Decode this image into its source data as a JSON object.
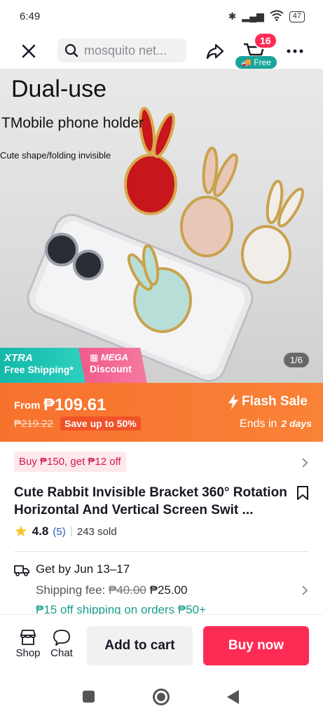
{
  "status_bar": {
    "time": "6:49",
    "battery": "47"
  },
  "topbar": {
    "search_text": "mosquito net...",
    "cart_count": "16",
    "free_chip": "Free"
  },
  "hero": {
    "headline": "Dual-use",
    "subline": "TMobile phone holder",
    "tagline": "Cute shape/folding invisible",
    "image_counter": "1/6",
    "xtra_title": "XTRA",
    "xtra_sub": "Free Shipping*",
    "mega_title": "MEGA",
    "mega_sub": "Discount"
  },
  "flash": {
    "from_label": "From",
    "price": "₱109.61",
    "original_price": "₱219.22",
    "save_text": "Save up to 50%",
    "title": "Flash Sale",
    "ends_label": "Ends in",
    "ends_value": "2 days"
  },
  "promo": {
    "text": "Buy ₱150, get ₱12 off"
  },
  "product": {
    "title": "Cute Rabbit Invisible Bracket 360° Rotation Horizontal And Vertical Screen Swit ...",
    "rating": "4.8",
    "review_count": "(5)",
    "sold": "243 sold"
  },
  "shipping": {
    "delivery": "Get by Jun 13–17",
    "fee_label": "Shipping fee:",
    "fee_old": "₱40.00",
    "fee_new": "₱25.00",
    "discount": "₱15 off shipping on orders ₱50+"
  },
  "bottom_bar": {
    "shop_label": "Shop",
    "chat_label": "Chat",
    "add_to_cart": "Add to cart",
    "buy_now": "Buy now"
  },
  "colors": {
    "accent": "#fe2c55",
    "flash": "#f7722d",
    "teal": "#1aa59b"
  }
}
